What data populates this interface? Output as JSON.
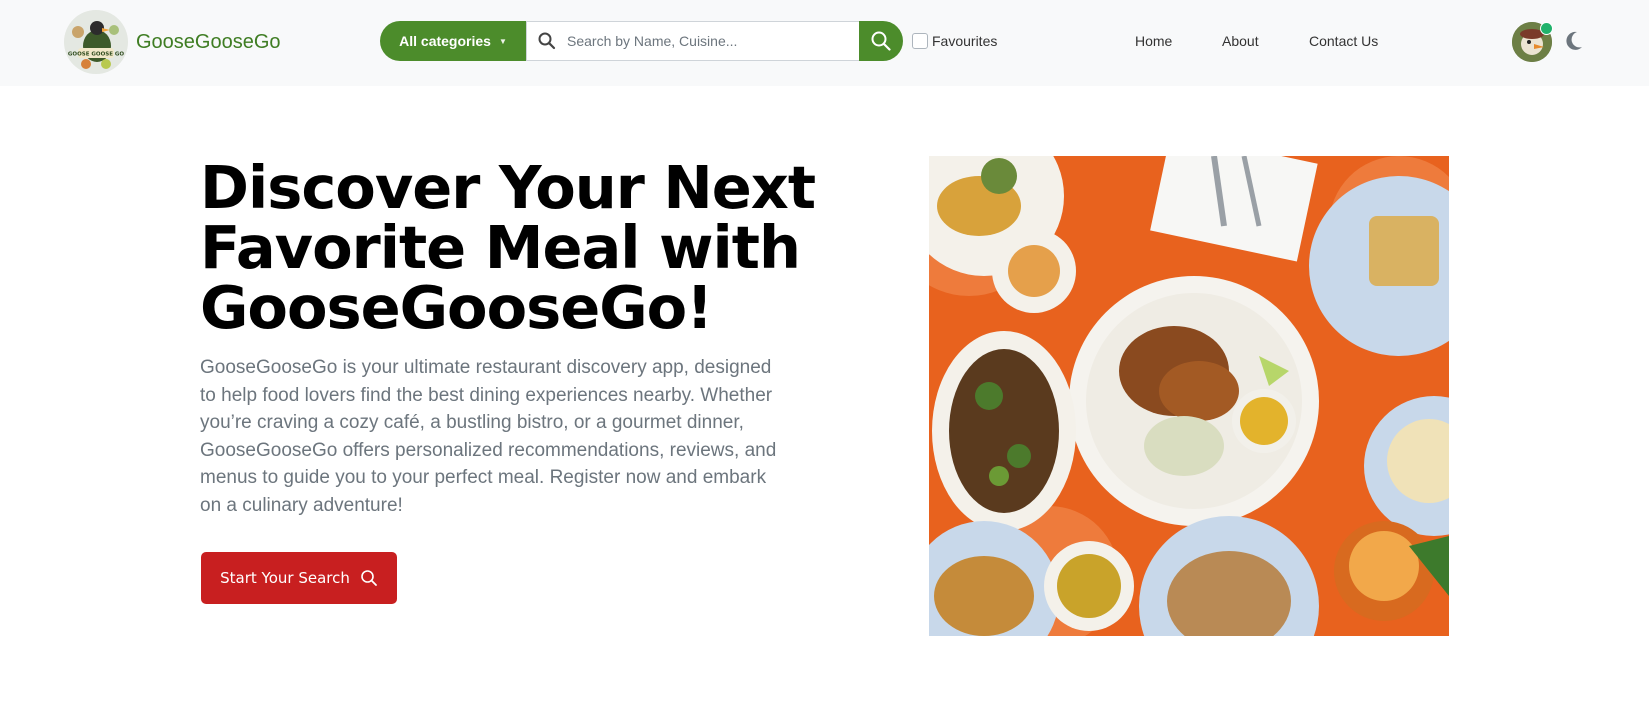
{
  "brand": {
    "name": "GooseGooseGo",
    "logo_text": "GOOSE GOOSE GO"
  },
  "search": {
    "category_label": "All categories",
    "placeholder": "Search by Name, Cuisine..."
  },
  "favourites": {
    "label": "Favourites",
    "checked": false
  },
  "nav": {
    "links": [
      "Home",
      "About",
      "Contact Us"
    ]
  },
  "icons": {
    "search": "search-icon",
    "theme": "moon-icon",
    "caret": "chevron-down-icon"
  },
  "colors": {
    "brand_green": "#4c8c2b",
    "cta_red": "#c81f20",
    "navbar_bg": "#f8f9fa",
    "online": "#20b26b"
  },
  "hero": {
    "title_lines": [
      "Discover Your Next",
      "Favorite Meal with",
      "GooseGooseGo!"
    ],
    "description": "GooseGooseGo is your ultimate restaurant discovery app, designed to help food lovers find the best dining experiences nearby. Whether you’re craving a cozy café, a bustling bistro, or a gourmet dinner, GooseGooseGo offers personalized recommendations, reviews, and menus to guide you to your perfect meal. Register now and embark on a culinary adventure!",
    "cta_label": "Start Your Search"
  }
}
